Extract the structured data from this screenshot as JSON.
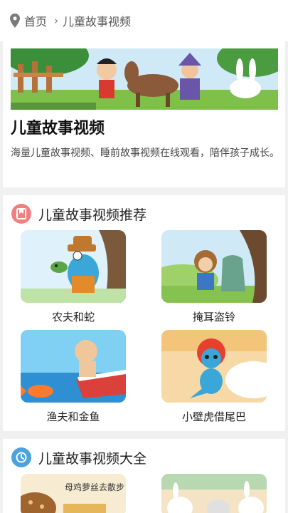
{
  "breadcrumb": {
    "home": "首页",
    "current": "儿童故事视频"
  },
  "hero": {
    "title": "儿童故事视频",
    "description": "海量儿童故事视频、睡前故事视频在线观看，陪伴孩子成长。"
  },
  "recommend": {
    "title": "儿童故事视频推荐",
    "icon": "bookmark-icon",
    "items": [
      {
        "title": "农夫和蛇"
      },
      {
        "title": "掩耳盗铃"
      },
      {
        "title": "渔夫和金鱼"
      },
      {
        "title": "小壁虎借尾巴"
      }
    ]
  },
  "all": {
    "title": "儿童故事视频大全",
    "icon": "clock-icon",
    "items": [
      {
        "title": "母鸡萝丝去散步"
      },
      {
        "title": ""
      }
    ]
  },
  "colors": {
    "accent": "#f08080",
    "clock": "#4aa3df",
    "text": "#222222"
  }
}
